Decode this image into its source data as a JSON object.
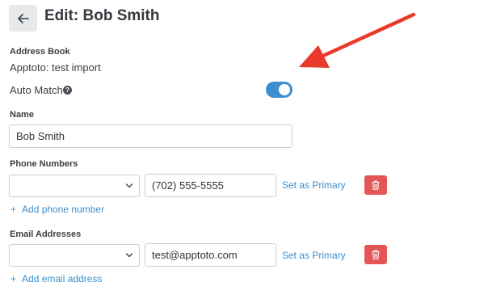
{
  "header": {
    "back_icon": "arrow-left-icon",
    "title": "Edit: Bob Smith"
  },
  "address_book": {
    "label": "Address Book",
    "value": "Apptoto: test import"
  },
  "auto_match": {
    "label": "Auto Match",
    "help_icon": "question-circle-icon",
    "help_glyph": "?",
    "enabled": true
  },
  "name": {
    "label": "Name",
    "value": "Bob Smith"
  },
  "phone_numbers": {
    "label": "Phone Numbers",
    "type_value": "",
    "number": "(702) 555-5555",
    "set_primary_label": "Set as Primary",
    "delete_icon": "trash-icon",
    "add_label": "Add phone number"
  },
  "email_addresses": {
    "label": "Email Addresses",
    "type_value": "",
    "email": "test@apptoto.com",
    "set_primary_label": "Set as Primary",
    "delete_icon": "trash-icon",
    "add_label": "Add email address"
  },
  "colors": {
    "accent": "#3a8fcf",
    "toggle_on": "#3b8fd1",
    "danger": "#e45656",
    "annotation_arrow": "#e8392b"
  }
}
